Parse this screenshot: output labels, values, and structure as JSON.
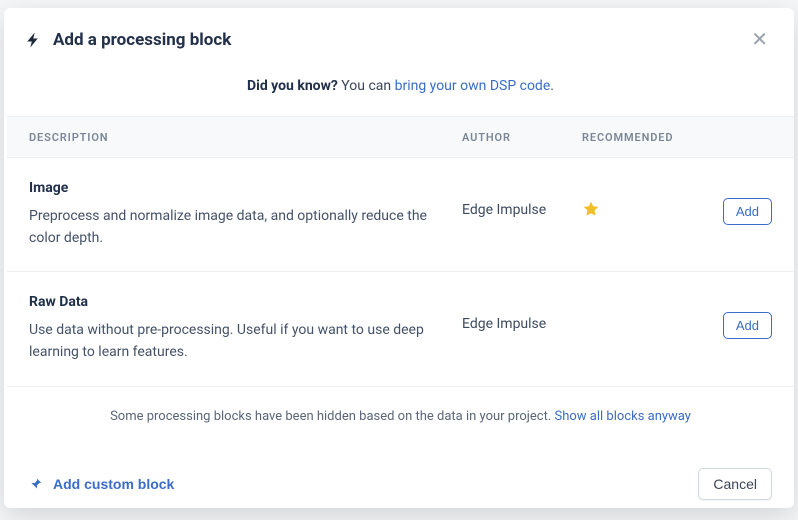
{
  "modal": {
    "title": "Add a processing block",
    "close_aria": "Close"
  },
  "tip": {
    "prefix_bold": "Did you know?",
    "middle": " You can ",
    "link": "bring your own DSP code",
    "suffix": "."
  },
  "table": {
    "headers": {
      "description": "DESCRIPTION",
      "author": "AUTHOR",
      "recommended": "RECOMMENDED"
    },
    "rows": [
      {
        "title": "Image",
        "desc": "Preprocess and normalize image data, and optionally reduce the color depth.",
        "author": "Edge Impulse",
        "recommended": true,
        "add_label": "Add"
      },
      {
        "title": "Raw Data",
        "desc": "Use data without pre-processing. Useful if you want to use deep learning to learn features.",
        "author": "Edge Impulse",
        "recommended": false,
        "add_label": "Add"
      }
    ]
  },
  "hidden_note": {
    "text": "Some processing blocks have been hidden based on the data in your project. ",
    "link": "Show all blocks anyway"
  },
  "footer": {
    "add_custom": "Add custom block",
    "cancel": "Cancel"
  }
}
